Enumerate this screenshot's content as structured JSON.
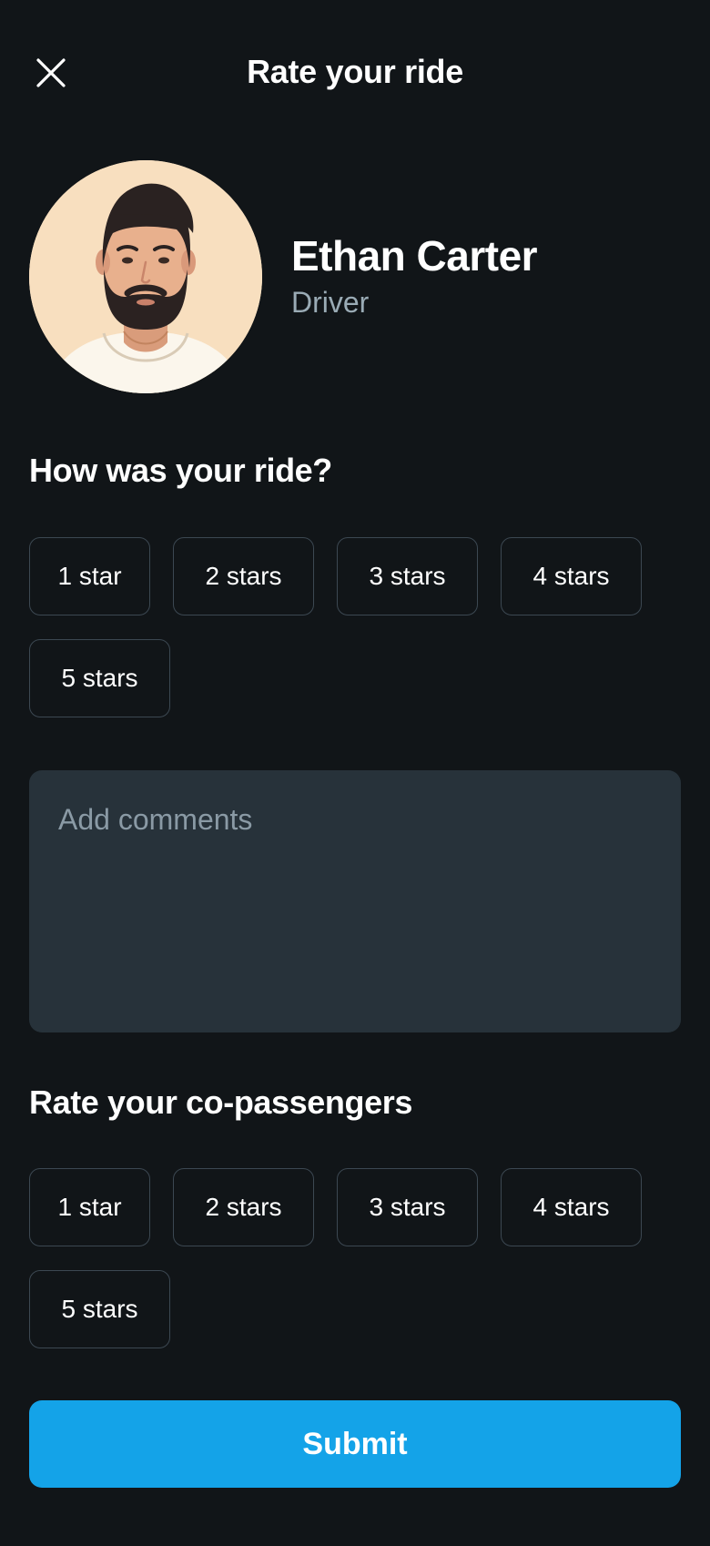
{
  "header": {
    "title": "Rate your ride",
    "close_icon": "close-icon"
  },
  "driver": {
    "name": "Ethan Carter",
    "role": "Driver"
  },
  "ride_rating": {
    "title": "How was your ride?",
    "options": [
      "1 star",
      "2 stars",
      "3 stars",
      "4 stars",
      "5 stars"
    ]
  },
  "comments": {
    "placeholder": "Add comments",
    "value": ""
  },
  "co_passenger_rating": {
    "title": "Rate your co-passengers",
    "options": [
      "1 star",
      "2 stars",
      "3 stars",
      "4 stars",
      "5 stars"
    ]
  },
  "submit": {
    "label": "Submit"
  },
  "colors": {
    "background": "#111518",
    "accent": "#14a3e8",
    "input_bg": "#27323a",
    "chip_border": "#3c4852",
    "muted_text": "#9aabb5"
  }
}
